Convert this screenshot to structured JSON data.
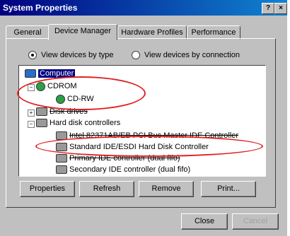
{
  "window": {
    "title": "System Properties",
    "help_label": "?",
    "close_label": "×"
  },
  "tabs": [
    {
      "label": "General"
    },
    {
      "label": "Device Manager"
    },
    {
      "label": "Hardware Profiles"
    },
    {
      "label": "Performance"
    }
  ],
  "view_options": {
    "by_type": "View devices by type",
    "by_connection": "View devices by connection",
    "selected": "View devices by type"
  },
  "tree": {
    "computer": "Computer",
    "cdrom": "CDROM",
    "cdrw": "CD-RW",
    "disk_drives": "Disk drives",
    "hard_disk_controllers": "Hard disk controllers",
    "intel_controller": "Intel 82371AB/EB PCI Bus Master IDE Controller",
    "standard_controller": "Standard IDE/ESDI Hard Disk Controller",
    "primary_ide": "Primary IDE controller (dual fifo)",
    "secondary_ide": "Secondary IDE controller (dual fifo)",
    "expand_minus": "−",
    "expand_plus": "+"
  },
  "buttons": {
    "properties": "Properties",
    "refresh": "Refresh",
    "remove": "Remove",
    "print": "Print...",
    "close": "Close",
    "cancel": "Cancel"
  },
  "colors": {
    "title_bar": "#000080",
    "annotation": "#e02020",
    "selection": "#000080"
  }
}
